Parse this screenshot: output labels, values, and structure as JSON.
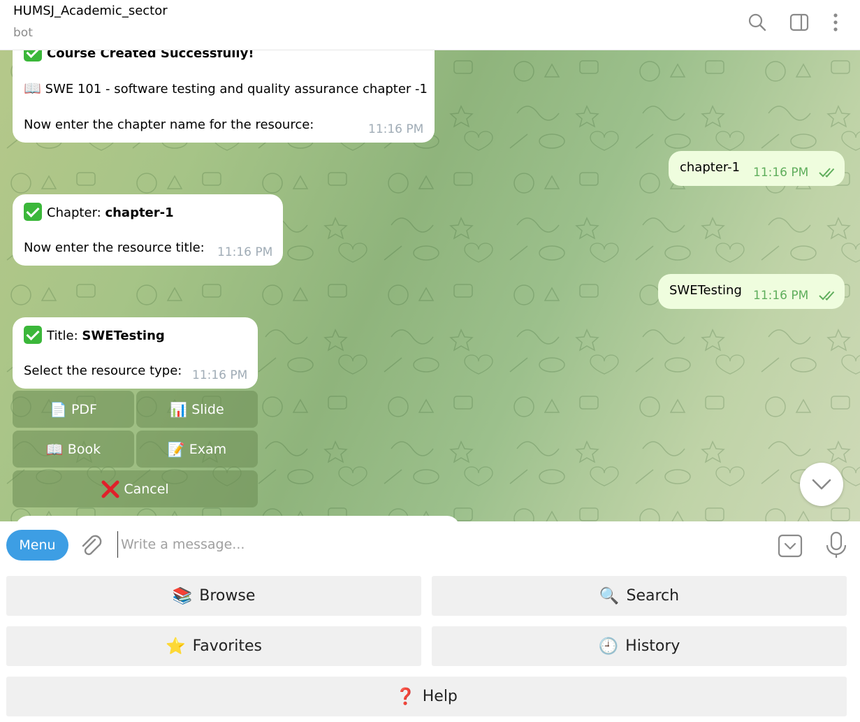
{
  "header": {
    "title": "HUMSJ_Academic_sector",
    "subtitle": "bot"
  },
  "messages": {
    "m1": {
      "line1": "Course Created Successfully!",
      "line2": "SWE 101 - software testing and quality assurance chapter -1",
      "line3": "Now enter the chapter name for the resource:",
      "time": "11:16 PM"
    },
    "m2": {
      "text": "chapter-1",
      "time": "11:16 PM"
    },
    "m3": {
      "label": "Chapter: ",
      "value": "chapter-1",
      "line2": "Now enter the resource title:",
      "time": "11:16 PM"
    },
    "m4": {
      "text": "SWETesting",
      "time": "11:16 PM"
    },
    "m5": {
      "label": "Title: ",
      "value": "SWETesting",
      "line2": "Select the resource type:",
      "time": "11:16 PM"
    }
  },
  "inline_keyboard": {
    "pdf": "PDF",
    "slide": "Slide",
    "book": "Book",
    "exam": "Exam",
    "cancel": "Cancel"
  },
  "composer": {
    "menu_label": "Menu",
    "placeholder": "Write a message..."
  },
  "reply_keyboard": {
    "browse": "Browse",
    "search": "Search",
    "favorites": "Favorites",
    "history": "History",
    "help": "Help"
  },
  "colors": {
    "accent": "#3d9ee4",
    "outgoing_bubble": "#effdde",
    "read_ticks": "#5fae5c"
  }
}
